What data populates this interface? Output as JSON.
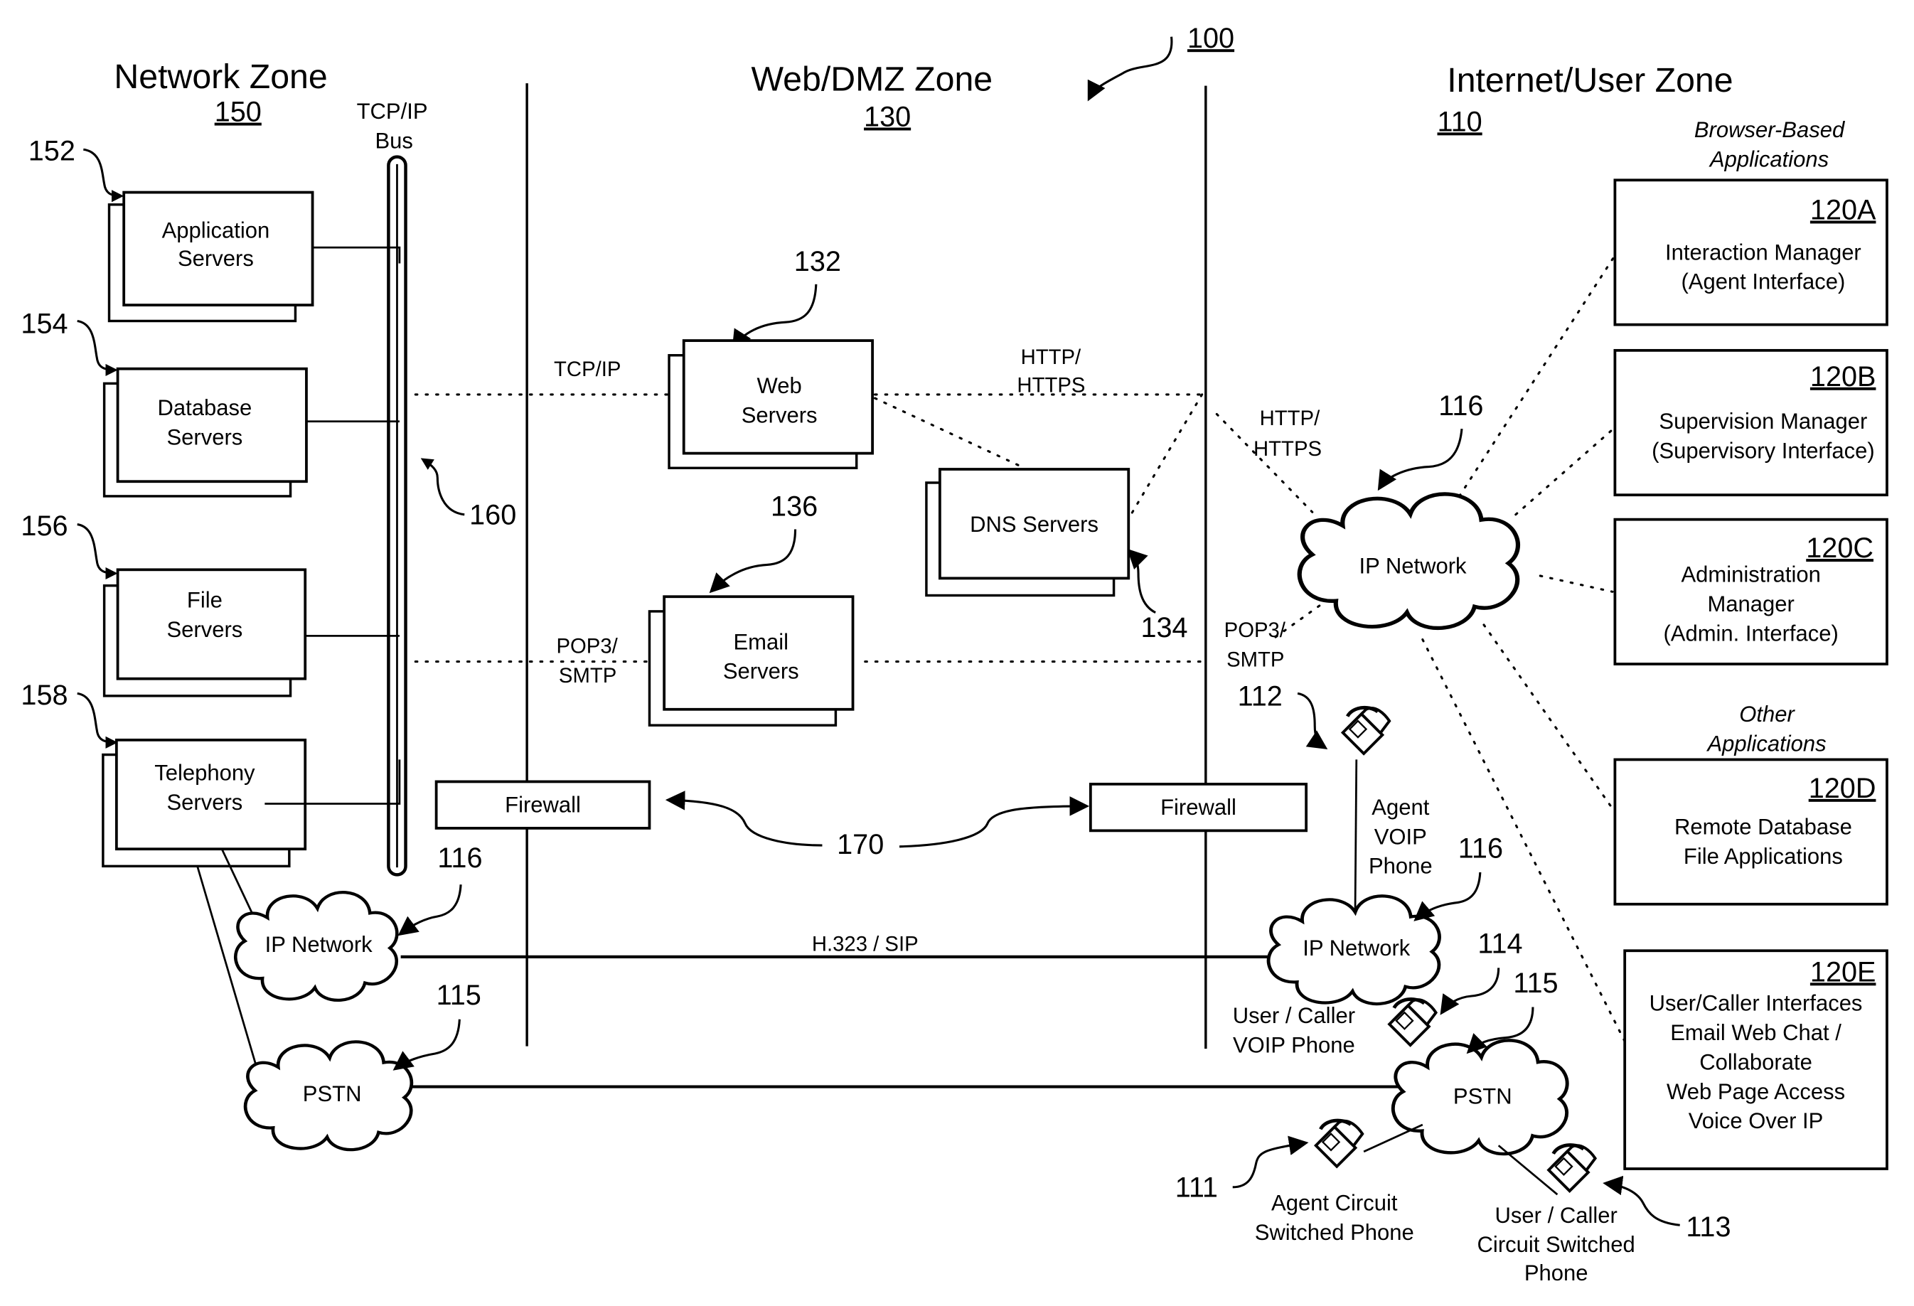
{
  "figure": {
    "ref": "100",
    "zones": [
      {
        "title": "Network Zone",
        "ref": "150"
      },
      {
        "title": "Web/DMZ Zone",
        "ref": "130"
      },
      {
        "title": "Internet/User Zone",
        "ref": "110"
      }
    ],
    "bus": {
      "label_line1": "TCP/IP",
      "label_line2": "Bus",
      "ref": "160"
    },
    "network_servers": [
      {
        "ref": "152",
        "line1": "Application",
        "line2": "Servers"
      },
      {
        "ref": "154",
        "line1": "Database",
        "line2": "Servers"
      },
      {
        "ref": "156",
        "line1": "File",
        "line2": "Servers"
      },
      {
        "ref": "158",
        "line1": "Telephony",
        "line2": "Servers"
      }
    ],
    "dmz_servers": {
      "web": {
        "ref": "132",
        "line1": "Web",
        "line2": "Servers"
      },
      "dns": {
        "ref": "134",
        "label": "DNS Servers"
      },
      "email": {
        "ref": "136",
        "line1": "Email",
        "line2": "Servers"
      }
    },
    "protocols": {
      "tcpip": "TCP/IP",
      "http1_line1": "HTTP/",
      "http1_line2": "HTTPS",
      "http2_line1": "HTTP/",
      "http2_line2": "HTTPS",
      "pop1_line1": "POP3/",
      "pop1_line2": "SMTP",
      "pop2_line1": "POP3/",
      "pop2_line2": "SMTP",
      "h323": "H.323 / SIP"
    },
    "firewalls": {
      "ref": "170",
      "left_label": "Firewall",
      "right_label": "Firewall"
    },
    "clouds": {
      "left_ip": {
        "ref": "116",
        "label": "IP Network"
      },
      "left_pstn": {
        "ref": "115",
        "label": "PSTN"
      },
      "main_ip": {
        "ref": "116",
        "label": "IP Network"
      },
      "right_ip": {
        "ref": "116",
        "label": "IP Network"
      },
      "right_pstn": {
        "ref": "115",
        "label": "PSTN"
      }
    },
    "phones": {
      "agent_voip": {
        "ref": "112",
        "line1": "Agent",
        "line2": "VOIP",
        "line3": "Phone"
      },
      "user_voip": {
        "ref": "114",
        "line1": "User / Caller",
        "line2": "VOIP Phone"
      },
      "agent_circuit": {
        "ref": "111",
        "line1": "Agent Circuit",
        "line2": "Switched Phone"
      },
      "user_circuit": {
        "ref": "113",
        "line1": "User / Caller",
        "line2": "Circuit Switched",
        "line3": "Phone"
      }
    },
    "app_groups": {
      "browser_line1": "Browser-Based",
      "browser_line2": "Applications",
      "other_line1": "Other",
      "other_line2": "Applications"
    },
    "applications": [
      {
        "ref": "120A",
        "lines": [
          "Interaction Manager",
          "(Agent Interface)"
        ]
      },
      {
        "ref": "120B",
        "lines": [
          "Supervision Manager",
          "(Supervisory Interface)"
        ]
      },
      {
        "ref": "120C",
        "lines": [
          "Administration",
          "Manager",
          "(Admin. Interface)"
        ]
      },
      {
        "ref": "120D",
        "lines": [
          "Remote Database",
          "File Applications"
        ]
      },
      {
        "ref": "120E",
        "lines": [
          "User/Caller Interfaces",
          "Email Web Chat /",
          "Collaborate",
          "Web Page Access",
          "Voice Over IP"
        ]
      }
    ]
  }
}
